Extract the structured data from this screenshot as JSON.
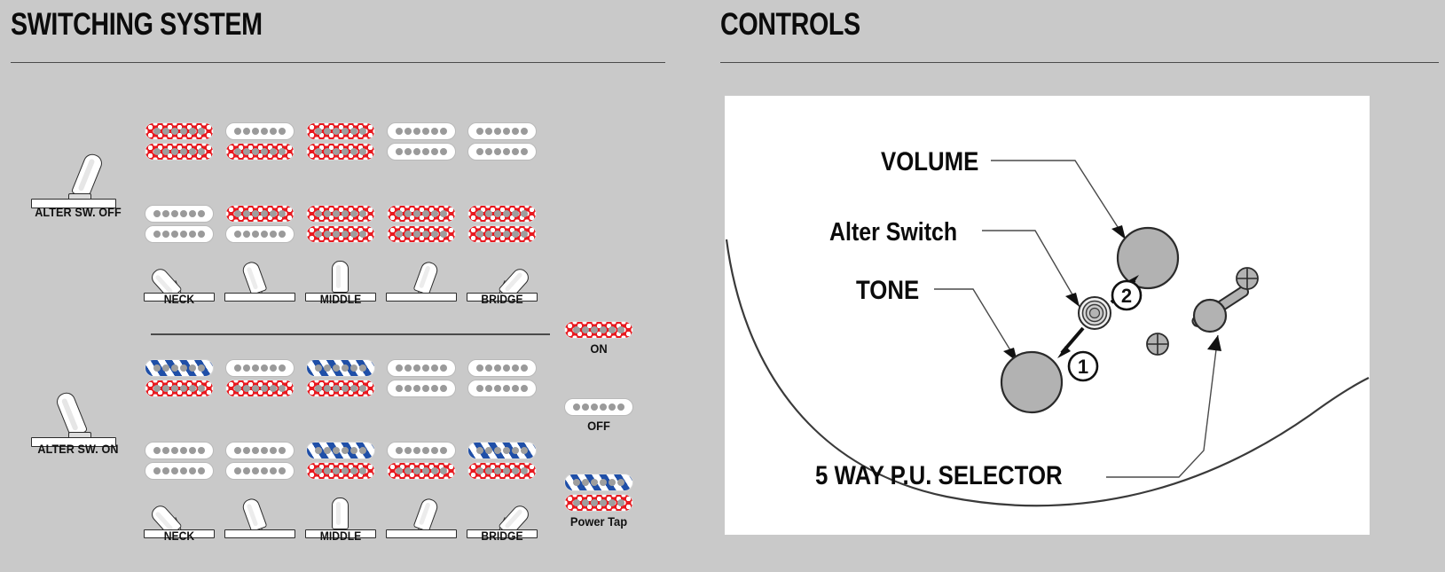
{
  "page": {
    "background_color": "#c9c9c9",
    "panel_color": "#ffffff"
  },
  "sections": {
    "switching": {
      "title": "SWITCHING SYSTEM"
    },
    "controls": {
      "title": "CONTROLS"
    }
  },
  "colors": {
    "pickup_on_red": "#e8191f",
    "pickup_off_white": "#ffffff",
    "power_tap_blue": "#1f4fa8",
    "pole_gray": "#9a9a9a",
    "knob_gray": "#b2b2b2",
    "outline": "#2b2b2b"
  },
  "switching_system": {
    "positions": [
      "NECK",
      "",
      "MIDDLE",
      "",
      "BRIDGE"
    ],
    "position_labels_visible": [
      "NECK",
      "MIDDLE",
      "BRIDGE"
    ],
    "blocks": [
      {
        "id": "alter-sw-off",
        "label": "ALTER SW. OFF",
        "toggle_state": "off",
        "columns": [
          {
            "position": 1,
            "name": "NECK",
            "top": [
              "on",
              "on"
            ],
            "bottom": [
              "off",
              "off"
            ]
          },
          {
            "position": 2,
            "name": "",
            "top": [
              "off",
              "on"
            ],
            "bottom": [
              "on",
              "off"
            ]
          },
          {
            "position": 3,
            "name": "MIDDLE",
            "top": [
              "on",
              "on"
            ],
            "bottom": [
              "on",
              "on"
            ]
          },
          {
            "position": 4,
            "name": "",
            "top": [
              "off",
              "off"
            ],
            "bottom": [
              "on",
              "on"
            ]
          },
          {
            "position": 5,
            "name": "BRIDGE",
            "top": [
              "off",
              "off"
            ],
            "bottom": [
              "on",
              "on"
            ]
          }
        ]
      },
      {
        "id": "alter-sw-on",
        "label": "ALTER SW. ON",
        "toggle_state": "on",
        "columns": [
          {
            "position": 1,
            "name": "NECK",
            "top": [
              "tap",
              "on"
            ],
            "bottom": [
              "off",
              "off"
            ]
          },
          {
            "position": 2,
            "name": "",
            "top": [
              "off",
              "on"
            ],
            "bottom": [
              "off",
              "off"
            ]
          },
          {
            "position": 3,
            "name": "MIDDLE",
            "top": [
              "tap",
              "on"
            ],
            "bottom": [
              "tap",
              "on"
            ]
          },
          {
            "position": 4,
            "name": "",
            "top": [
              "off",
              "off"
            ],
            "bottom": [
              "off",
              "on"
            ]
          },
          {
            "position": 5,
            "name": "BRIDGE",
            "top": [
              "off",
              "off"
            ],
            "bottom": [
              "tap",
              "on"
            ]
          }
        ]
      }
    ],
    "legend": [
      {
        "key": "on",
        "label": "ON",
        "coils": [
          "on"
        ]
      },
      {
        "key": "off",
        "label": "OFF",
        "coils": [
          "off"
        ]
      },
      {
        "key": "tap",
        "label": "Power Tap",
        "coils": [
          "tap",
          "on"
        ]
      }
    ]
  },
  "controls_diagram": {
    "labels": [
      {
        "id": "volume",
        "text": "VOLUME"
      },
      {
        "id": "alter",
        "text": "Alter Switch"
      },
      {
        "id": "tone",
        "text": "TONE"
      },
      {
        "id": "selector",
        "text": "5 WAY P.U. SELECTOR"
      }
    ],
    "callouts": [
      {
        "id": "step-1",
        "text": "1"
      },
      {
        "id": "step-2",
        "text": "2"
      }
    ],
    "parts": [
      {
        "id": "volume-knob",
        "type": "knob"
      },
      {
        "id": "tone-knob",
        "type": "knob"
      },
      {
        "id": "alter-switch",
        "type": "mini-toggle"
      },
      {
        "id": "pu-selector",
        "type": "lever-switch"
      },
      {
        "id": "screw-upper",
        "type": "screw"
      },
      {
        "id": "screw-lower",
        "type": "screw"
      }
    ]
  }
}
